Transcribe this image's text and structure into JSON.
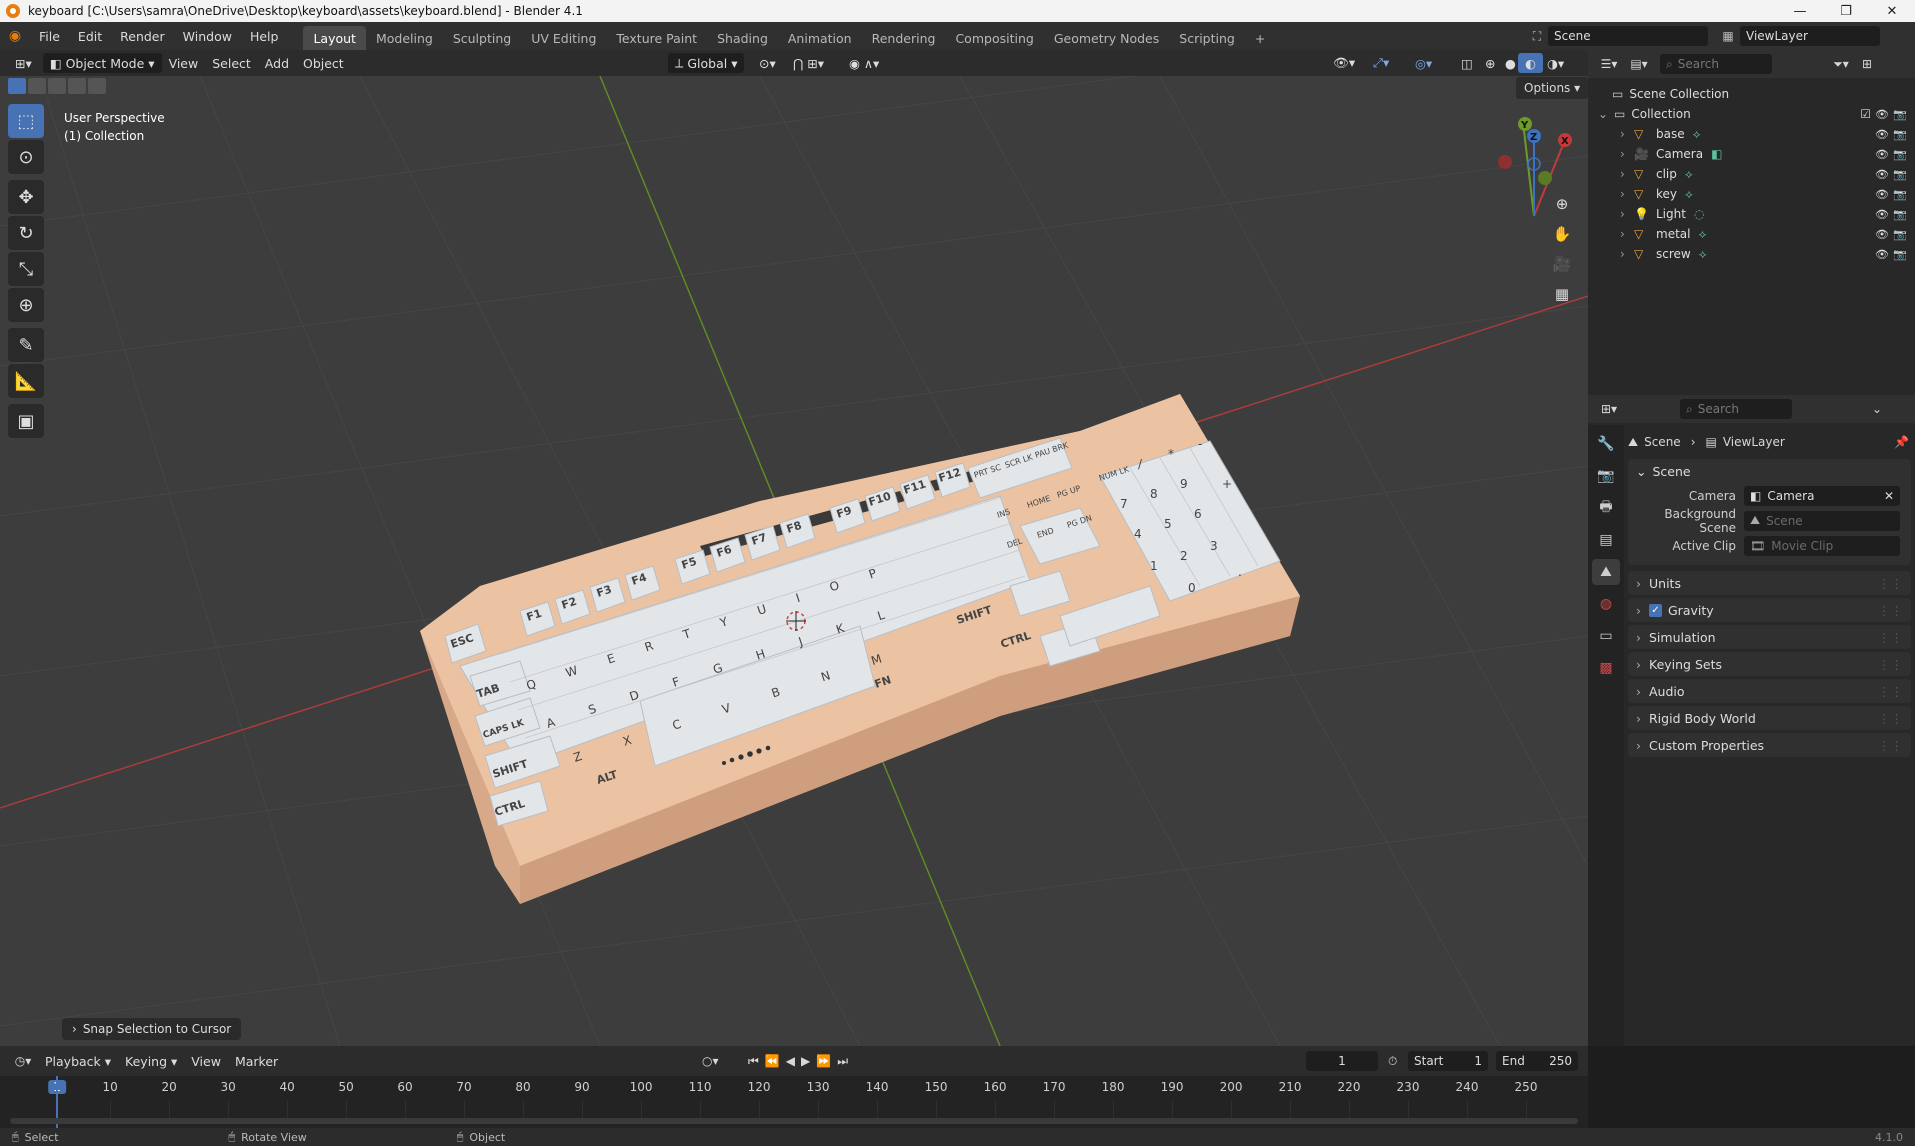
{
  "window": {
    "title": "keyboard [C:\\Users\\samra\\OneDrive\\Desktop\\keyboard\\assets\\keyboard.blend] - Blender 4.1",
    "controls": [
      "—",
      "❐",
      "✕"
    ]
  },
  "topbar": {
    "menus": [
      "File",
      "Edit",
      "Render",
      "Window",
      "Help"
    ],
    "workspaces": [
      "Layout",
      "Modeling",
      "Sculpting",
      "UV Editing",
      "Texture Paint",
      "Shading",
      "Animation",
      "Rendering",
      "Compositing",
      "Geometry Nodes",
      "Scripting"
    ],
    "active_workspace": "Layout",
    "add_tab": "+",
    "scene_name": "Scene",
    "view_layer": "ViewLayer"
  },
  "viewport_header": {
    "mode": "Object Mode",
    "menus": [
      "View",
      "Select",
      "Add",
      "Object"
    ],
    "orientation": "Global",
    "options_label": "Options"
  },
  "viewport": {
    "perspective": "User Perspective",
    "collection": "(1) Collection",
    "last_op": "Snap Selection to Cursor",
    "gizmo": {
      "x": "X",
      "y": "Y",
      "z": "Z"
    }
  },
  "keyboard": {
    "fn_row": [
      "F1",
      "F2",
      "F3",
      "F4",
      "F5",
      "F6",
      "F7",
      "F8",
      "F9",
      "F10",
      "F11",
      "F12"
    ],
    "esc": "ESC",
    "row_labels": {
      "tab": "TAB",
      "caps": "CAPS LK",
      "shift_l": "SHIFT",
      "ctrl_l": "CTRL",
      "alt": "ALT",
      "fn": "FN",
      "ctrl_r": "CTRL",
      "shift_r": "SHIFT"
    },
    "row_q": [
      "Q",
      "W",
      "E",
      "R",
      "T",
      "Y",
      "U",
      "I",
      "O",
      "P"
    ],
    "row_a": [
      "A",
      "S",
      "D",
      "F",
      "G",
      "H",
      "J",
      "K",
      "L"
    ],
    "row_z": [
      "Z",
      "X",
      "C",
      "V",
      "B",
      "N",
      "M"
    ],
    "nav": [
      "PRT SC",
      "SCR LK",
      "PAU BRK",
      "INS",
      "HOME",
      "PG UP",
      "DEL",
      "END",
      "PG DN"
    ],
    "numpad": [
      "NUM LK",
      "/",
      "*",
      "-",
      "7",
      "8",
      "9",
      "+",
      "4",
      "5",
      "6",
      "1",
      "2",
      "3",
      "0",
      "."
    ]
  },
  "outliner": {
    "search_placeholder": "Search",
    "scene_collection": "Scene Collection",
    "collection": "Collection",
    "items": [
      {
        "name": "base",
        "type": "mesh"
      },
      {
        "name": "Camera",
        "type": "camera"
      },
      {
        "name": "clip",
        "type": "mesh"
      },
      {
        "name": "key",
        "type": "mesh"
      },
      {
        "name": "Light",
        "type": "light"
      },
      {
        "name": "metal",
        "type": "mesh"
      },
      {
        "name": "screw",
        "type": "mesh"
      }
    ]
  },
  "properties": {
    "search_placeholder": "Search",
    "breadcrumb": [
      "Scene",
      "ViewLayer"
    ],
    "panel_title": "Scene",
    "fields": [
      {
        "label": "Camera",
        "value": "Camera"
      },
      {
        "label": "Background Scene",
        "value": "Scene"
      },
      {
        "label": "Active Clip",
        "value": "Movie Clip"
      }
    ],
    "sections": [
      "Units",
      "Gravity",
      "Simulation",
      "Keying Sets",
      "Audio",
      "Rigid Body World",
      "Custom Properties"
    ],
    "gravity_checked": true
  },
  "timeline": {
    "menus": [
      "Playback",
      "Keying",
      "View",
      "Marker"
    ],
    "current_frame": "1",
    "start_label": "Start",
    "start": "1",
    "end_label": "End",
    "end": "250",
    "ticks": [
      "1",
      "10",
      "20",
      "30",
      "40",
      "50",
      "60",
      "70",
      "80",
      "90",
      "100",
      "110",
      "120",
      "130",
      "140",
      "150",
      "160",
      "170",
      "180",
      "190",
      "200",
      "210",
      "220",
      "230",
      "240",
      "250"
    ]
  },
  "statusbar": {
    "items": [
      "Select",
      "Rotate View",
      "Object"
    ],
    "version": "4.1.0"
  },
  "colors": {
    "accent": "#4772b3",
    "x_axis": "#c23a3a",
    "y_axis": "#6e9a2b",
    "keyboard_body": "#e9c0a0",
    "keycap": "#e6e8ea"
  }
}
